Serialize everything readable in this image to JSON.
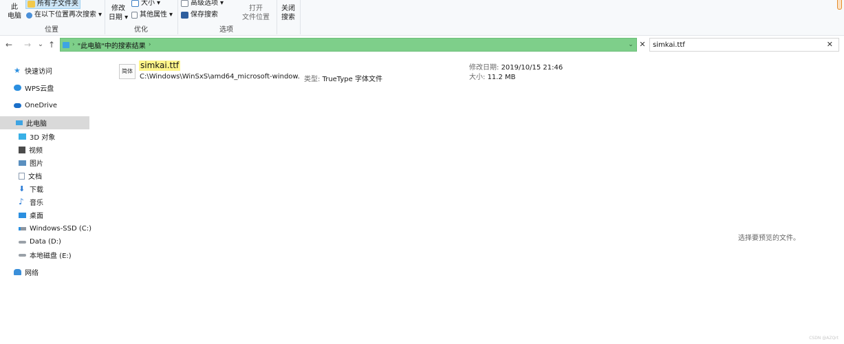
{
  "colors": {
    "address_bar_bg": "#7ecf8a",
    "filename_highlight": "#fff58a",
    "selected_nav_bg": "#d9d9d9",
    "ribbon_bg": "#f7f9fb",
    "accent_blue": "#2b8fe0"
  },
  "ribbon": {
    "location": {
      "this_pc": "此",
      "this_pc_2": "电脑",
      "all_subfolders": "所有子文件夹",
      "search_again": "在以下位置再次搜索",
      "group_label": "位置"
    },
    "optimize": {
      "modified_1": "修改",
      "modified_2": "日期",
      "size": "大小",
      "other_props": "其他属性",
      "group_label": "优化"
    },
    "options": {
      "advanced": "高级选项",
      "save_search": "保存搜索",
      "open_loc_1": "打开",
      "open_loc_2": "文件位置",
      "close_1": "关闭",
      "close_2": "搜索",
      "group_label": "选项"
    }
  },
  "nav": {
    "back_icon": "←",
    "forward_icon": "→",
    "recent_icon": "⌄",
    "up_icon": "↑"
  },
  "address": {
    "path": "\"此电脑\"中的搜索结果",
    "chevron": "›",
    "trail_chevron": "›"
  },
  "search": {
    "value": "simkai.ttf",
    "clear_icon": "✕"
  },
  "sidebar": {
    "items": [
      {
        "label": "快速访问",
        "icon": "star-icon",
        "color": "#2b8fe0"
      },
      {
        "label": "WPS云盘",
        "icon": "cloud-icon",
        "color": "#2b8fe0"
      },
      {
        "label": "OneDrive",
        "icon": "onedrive-icon",
        "color": "#1a6fc9"
      },
      {
        "label": "此电脑",
        "icon": "computer-icon",
        "color": "#3ea4e3"
      },
      {
        "label": "3D 对象",
        "icon": "3d-objects-icon",
        "color": "#39b0e6"
      },
      {
        "label": "视频",
        "icon": "video-icon",
        "color": "#4b4b4b"
      },
      {
        "label": "图片",
        "icon": "pictures-icon",
        "color": "#5a8fbf"
      },
      {
        "label": "文档",
        "icon": "documents-icon",
        "color": "#8a9bb0"
      },
      {
        "label": "下载",
        "icon": "download-icon",
        "color": "#2b7bd6"
      },
      {
        "label": "音乐",
        "icon": "music-icon",
        "color": "#2b7bd6"
      },
      {
        "label": "桌面",
        "icon": "desktop-icon",
        "color": "#2b8fe0"
      },
      {
        "label": "Windows-SSD (C:)",
        "icon": "drive-c-icon",
        "color": "#8e969f"
      },
      {
        "label": "Data (D:)",
        "icon": "drive-icon",
        "color": "#9aa1a8"
      },
      {
        "label": "本地磁盘 (E:)",
        "icon": "drive-icon",
        "color": "#9aa1a8"
      },
      {
        "label": "网络",
        "icon": "network-icon",
        "color": "#3a8fd9"
      }
    ]
  },
  "results": {
    "file": {
      "icon_label": "简体",
      "name": "simkai.ttf",
      "path": "C:\\Windows\\WinSxS\\amd64_microsoft-window...",
      "type_label": "类型:",
      "type_value": "TrueType 字体文件",
      "modified_label": "修改日期:",
      "modified_value": "2019/10/15 21:46",
      "size_label": "大小:",
      "size_value": "11.2 MB"
    }
  },
  "preview": {
    "empty_message": "选择要预览的文件。"
  },
  "watermark": "CSDN @AZQrt"
}
